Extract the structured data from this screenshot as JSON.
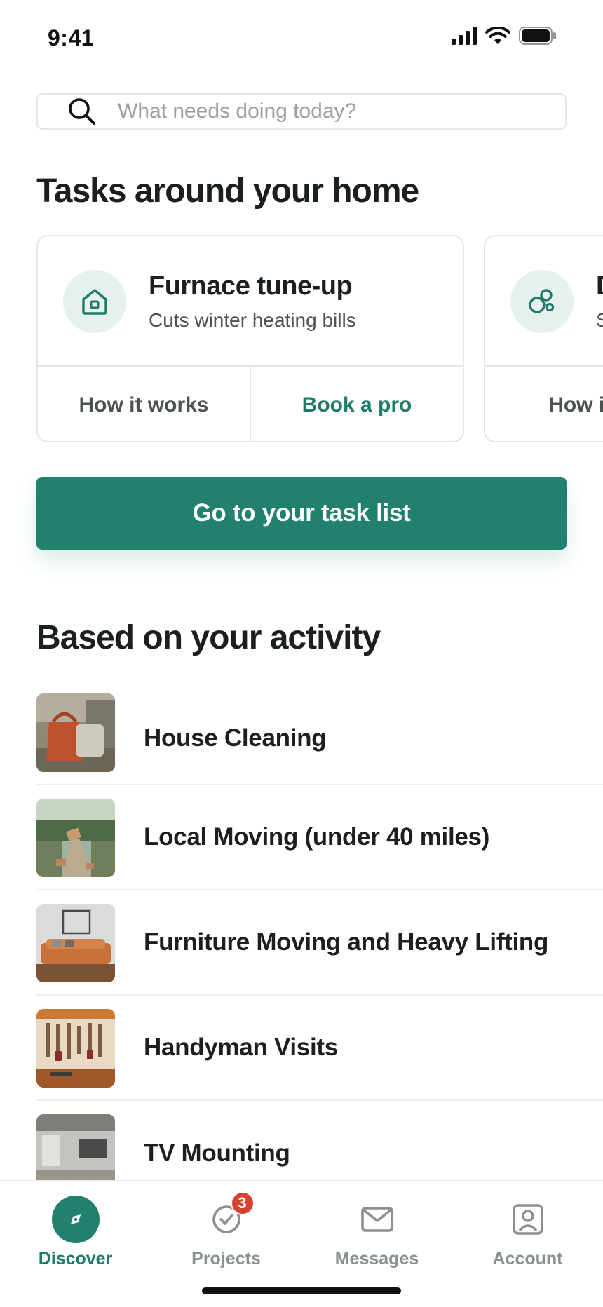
{
  "status_bar": {
    "time": "9:41"
  },
  "search": {
    "placeholder": "What needs doing today?"
  },
  "tasks_section": {
    "title": "Tasks around your home",
    "cards": [
      {
        "icon": "house-icon",
        "title": "Furnace tune-up",
        "subtitle": "Cuts winter heating bills",
        "secondary_action": "How it works",
        "primary_action": "Book a pro"
      },
      {
        "icon": "bubbles-icon",
        "title": "D",
        "subtitle": "S",
        "secondary_action": "How it w",
        "primary_action": ""
      }
    ]
  },
  "task_list_button": {
    "label": "Go to your task list"
  },
  "activity_section": {
    "title": "Based on your activity",
    "items": [
      {
        "label": "House Cleaning"
      },
      {
        "label": "Local Moving (under 40 miles)"
      },
      {
        "label": "Furniture Moving and Heavy Lifting"
      },
      {
        "label": "Handyman Visits"
      },
      {
        "label": "TV Mounting"
      }
    ]
  },
  "bottom_nav": {
    "items": [
      {
        "label": "Discover",
        "icon": "compass-icon",
        "active": true
      },
      {
        "label": "Projects",
        "icon": "check-circle-icon",
        "badge": "3"
      },
      {
        "label": "Messages",
        "icon": "envelope-icon"
      },
      {
        "label": "Account",
        "icon": "user-icon"
      }
    ]
  },
  "colors": {
    "brand": "#21806e",
    "brand_text": "#1f7a6a",
    "icon_bg": "#e6f0ed",
    "badge": "#d8412f"
  }
}
